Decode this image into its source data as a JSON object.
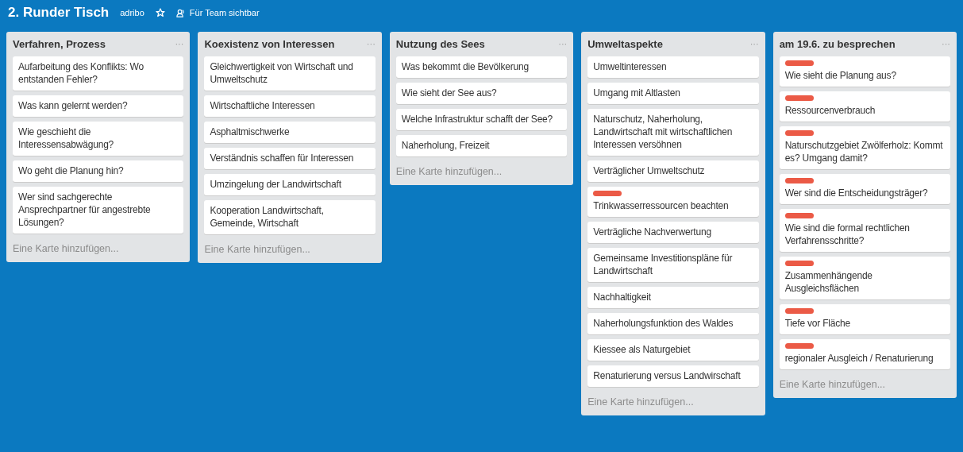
{
  "board": {
    "title": "2. Runder Tisch",
    "team": "adribo",
    "starred": false,
    "visibility": "Für Team sichtbar"
  },
  "lists": [
    {
      "title": "Verfahren, Prozess",
      "menu": "···",
      "cards": [
        {
          "text": "Aufarbeitung des Konflikts: Wo entstanden Fehler?"
        },
        {
          "text": "Was kann gelernt werden?"
        },
        {
          "text": "Wie geschieht die Interessensabwägung?"
        },
        {
          "text": "Wo geht die Planung hin?"
        },
        {
          "text": "Wer sind sachgerechte Ansprechpartner für angestrebte Lösungen?"
        }
      ],
      "add": "Eine Karte hinzufügen..."
    },
    {
      "title": "Koexistenz von Interessen",
      "menu": "···",
      "cards": [
        {
          "text": "Gleichwertigkeit von Wirtschaft und Umweltschutz"
        },
        {
          "text": "Wirtschaftliche Interessen"
        },
        {
          "text": "Asphaltmischwerke"
        },
        {
          "text": "Verständnis schaffen für Interessen"
        },
        {
          "text": "Umzingelung der Landwirtschaft"
        },
        {
          "text": "Kooperation Landwirtschaft, Gemeinde, Wirtschaft"
        }
      ],
      "add": "Eine Karte hinzufügen..."
    },
    {
      "title": "Nutzung des Sees",
      "menu": "···",
      "cards": [
        {
          "text": "Was bekommt die Bevölkerung"
        },
        {
          "text": "Wie sieht der See aus?"
        },
        {
          "text": "Welche Infrastruktur schafft der See?"
        },
        {
          "text": "Naherholung, Freizeit"
        }
      ],
      "add": "Eine Karte hinzufügen..."
    },
    {
      "title": "Umweltaspekte",
      "menu": "···",
      "cards": [
        {
          "text": "Umweltinteressen"
        },
        {
          "text": "Umgang mit Altlasten"
        },
        {
          "text": "Naturschutz, Naherholung, Landwirtschaft mit wirtschaftlichen Interessen versöhnen"
        },
        {
          "text": "Verträglicher Umweltschutz"
        },
        {
          "text": "Trinkwasserressourcen beachten",
          "color": "#eb5a46"
        },
        {
          "text": "Verträgliche Nachverwertung"
        },
        {
          "text": "Gemeinsame Investitionspläne für Landwirtschaft"
        },
        {
          "text": "Nachhaltigkeit"
        },
        {
          "text": "Naherholungsfunktion des Waldes"
        },
        {
          "text": "Kiessee als Naturgebiet"
        },
        {
          "text": "Renaturierung versus Landwirschaft"
        }
      ],
      "add": "Eine Karte hinzufügen..."
    },
    {
      "title": "am 19.6. zu besprechen",
      "menu": "···",
      "cards": [
        {
          "text": "Wie sieht die Planung aus?",
          "color": "#eb5a46"
        },
        {
          "text": "Ressourcenverbrauch",
          "color": "#eb5a46"
        },
        {
          "text": "Naturschutzgebiet Zwölferholz: Kommt es? Umgang damit?",
          "color": "#eb5a46"
        },
        {
          "text": "Wer sind die Entscheidungsträger?",
          "color": "#eb5a46"
        },
        {
          "text": "Wie sind die formal rechtlichen Verfahrensschritte?",
          "color": "#eb5a46"
        },
        {
          "text": "Zusammenhängende Ausgleichsflächen",
          "color": "#eb5a46"
        },
        {
          "text": "Tiefe vor Fläche",
          "color": "#eb5a46"
        },
        {
          "text": "regionaler Ausgleich / Renaturierung",
          "color": "#eb5a46"
        }
      ],
      "add": "Eine Karte hinzufügen..."
    }
  ]
}
